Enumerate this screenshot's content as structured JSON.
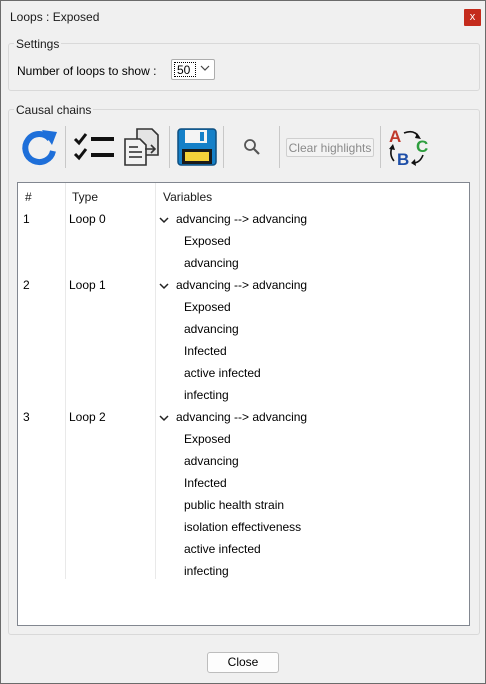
{
  "window": {
    "title": "Loops : Exposed",
    "close_glyph": "x"
  },
  "settings": {
    "legend": "Settings",
    "loops_label": "Number of loops to show :",
    "loops_value": "50"
  },
  "causal": {
    "legend": "Causal chains",
    "toolbar": {
      "refresh_icon": "refresh-icon",
      "checklist_icon": "checklist-icon",
      "copy_icon": "copy-document-icon",
      "save_icon": "save-disk-icon",
      "search_icon": "search-icon",
      "clear_highlights": "Clear highlights",
      "abc_icon": "abc-cycle-icon"
    },
    "columns": [
      "#",
      "Type",
      "Variables"
    ],
    "rows": [
      {
        "num": "1",
        "type": "Loop 0",
        "chain": "advancing --> advancing",
        "variables": [
          "Exposed",
          "advancing"
        ]
      },
      {
        "num": "2",
        "type": "Loop 1",
        "chain": "advancing --> advancing",
        "variables": [
          "Exposed",
          "advancing",
          "Infected",
          "active infected",
          "infecting"
        ]
      },
      {
        "num": "3",
        "type": "Loop 2",
        "chain": "advancing --> advancing",
        "variables": [
          "Exposed",
          "advancing",
          "Infected",
          "public health strain",
          "isolation effectiveness",
          "active infected",
          "infecting"
        ]
      }
    ]
  },
  "footer": {
    "close_label": "Close"
  },
  "colors": {
    "accent_blue": "#1e6fd9",
    "close_red": "#c42b1c",
    "save_blue": "#1580c8"
  }
}
